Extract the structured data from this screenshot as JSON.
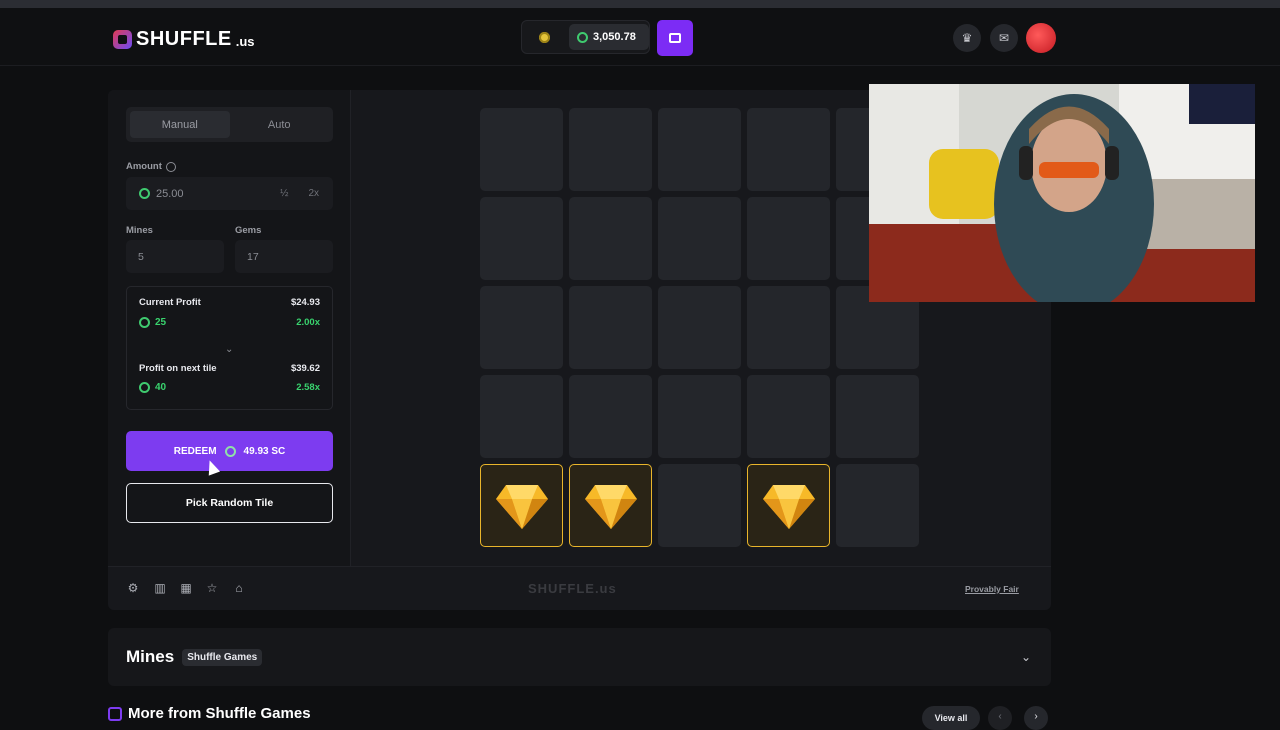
{
  "header": {
    "logo_text": "SHUFFLE",
    "logo_suffix": ".us",
    "balance": "3,050.78"
  },
  "controls": {
    "tabs": [
      "Manual",
      "Auto"
    ],
    "amount_label": "Amount",
    "amount_value": "25.00",
    "half_label": "½",
    "double_label": "2x",
    "mines_label": "Mines",
    "mines_value": "5",
    "gems_label": "Gems",
    "gems_value": "17",
    "current_profit_label": "Current Profit",
    "current_profit_usd": "$24.93",
    "current_profit_coins": "25",
    "current_multiplier": "2.00x",
    "next_profit_label": "Profit on next tile",
    "next_profit_usd": "$39.62",
    "next_profit_coins": "40",
    "next_multiplier": "2.58x",
    "redeem_label": "REDEEM",
    "redeem_amount": "49.93 SC",
    "pick_random_label": "Pick Random Tile"
  },
  "board": {
    "rows": 5,
    "cols": 5,
    "revealed_gems": [
      [
        4,
        0
      ],
      [
        4,
        1
      ],
      [
        4,
        3
      ]
    ]
  },
  "footer_bar": {
    "watermark": "SHUFFLE.us",
    "provably_fair": "Provably Fair"
  },
  "game_info": {
    "title": "Mines",
    "provider": "Shuffle Games"
  },
  "more_section": {
    "title": "More from Shuffle Games",
    "view_all": "View all"
  },
  "colors": {
    "accent": "#7d3cf0",
    "profit_green": "#39d36e",
    "gem_border": "#e9b52b"
  }
}
